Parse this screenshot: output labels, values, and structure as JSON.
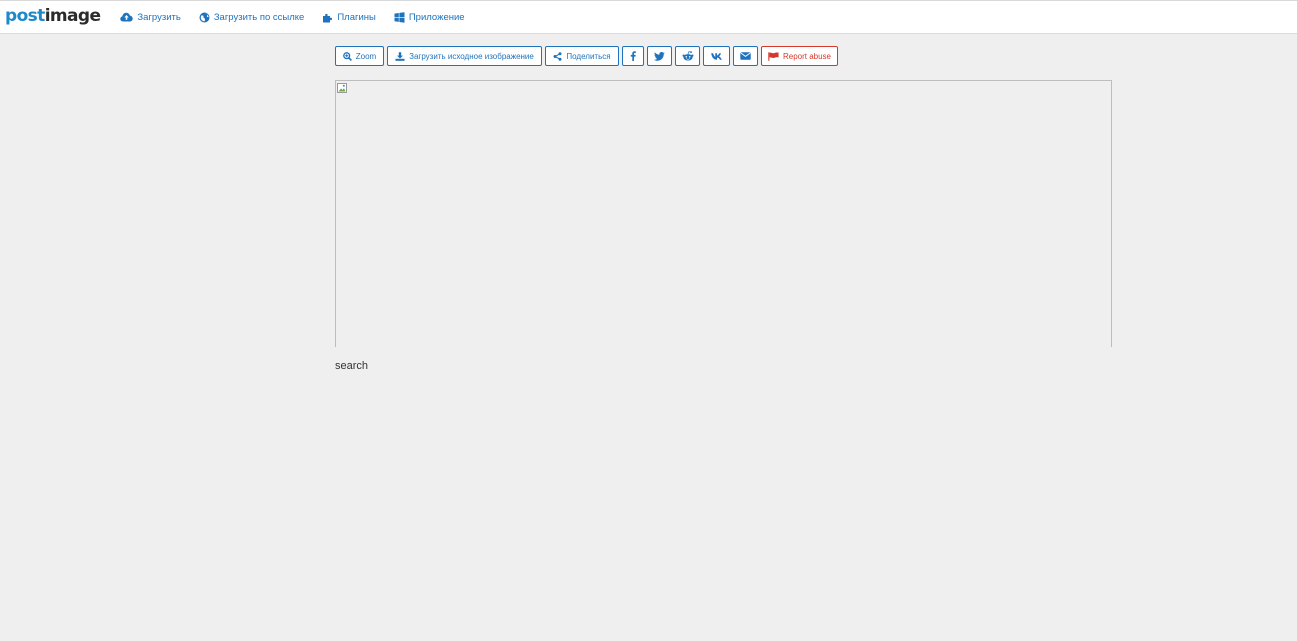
{
  "header": {
    "logo": {
      "part1": "post",
      "part2": "image"
    },
    "nav": [
      {
        "label": "Загрузить",
        "icon": "cloud-upload-icon"
      },
      {
        "label": "Загрузить по ссылке",
        "icon": "globe-icon"
      },
      {
        "label": "Плагины",
        "icon": "puzzle-icon"
      },
      {
        "label": "Приложение",
        "icon": "windows-icon"
      }
    ]
  },
  "toolbar": {
    "zoom_label": "Zoom",
    "download_label": "Загрузить исходное изображение",
    "share_label": "Поделиться",
    "report_label": "Report abuse",
    "social": [
      "facebook-icon",
      "twitter-icon",
      "reddit-icon",
      "vk-icon",
      "envelope-icon"
    ]
  },
  "image": {
    "alt": ""
  },
  "search": {
    "text": "search"
  },
  "colors": {
    "accent": "#1e73be",
    "danger": "#d33a2c",
    "background": "#efefef",
    "logo_blue": "#1e88c8"
  }
}
